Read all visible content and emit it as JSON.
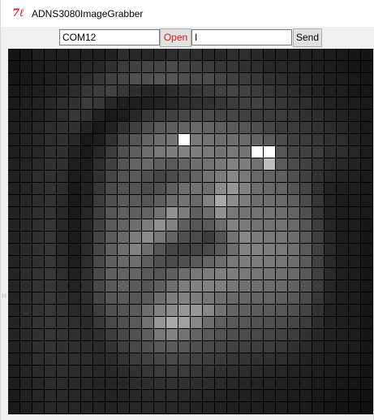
{
  "window": {
    "title": "ADNS3080ImageGrabber",
    "icon": "tk-feather-icon"
  },
  "toolbar": {
    "port_value": "COM12",
    "open_label": "Open",
    "command_value": "I",
    "send_label": "Send"
  },
  "image": {
    "grid_size": 30,
    "description_colors": {
      "background": "#000000",
      "accent": "#cc1f1f"
    },
    "pixels": [
      [
        20,
        22,
        30,
        30,
        30,
        30,
        32,
        30,
        33,
        45,
        40,
        38,
        40,
        45,
        50,
        45,
        40,
        40,
        45,
        45,
        40,
        35,
        35,
        33,
        30,
        30,
        28,
        25,
        22,
        20
      ],
      [
        20,
        25,
        28,
        30,
        30,
        35,
        40,
        40,
        50,
        60,
        65,
        70,
        70,
        75,
        70,
        65,
        60,
        55,
        55,
        50,
        45,
        40,
        40,
        40,
        35,
        30,
        30,
        25,
        22,
        20
      ],
      [
        22,
        25,
        28,
        32,
        35,
        40,
        45,
        55,
        65,
        70,
        80,
        80,
        85,
        85,
        80,
        75,
        75,
        70,
        65,
        60,
        55,
        50,
        45,
        40,
        38,
        35,
        30,
        28,
        25,
        22
      ],
      [
        25,
        28,
        30,
        35,
        40,
        45,
        55,
        60,
        65,
        55,
        45,
        40,
        40,
        45,
        50,
        55,
        60,
        65,
        70,
        65,
        60,
        55,
        50,
        45,
        40,
        35,
        30,
        30,
        25,
        22
      ],
      [
        25,
        30,
        35,
        40,
        45,
        50,
        60,
        55,
        40,
        30,
        30,
        32,
        35,
        40,
        45,
        48,
        50,
        55,
        60,
        65,
        65,
        60,
        55,
        50,
        45,
        40,
        35,
        30,
        28,
        24
      ],
      [
        28,
        30,
        35,
        40,
        45,
        55,
        50,
        35,
        25,
        28,
        40,
        55,
        60,
        65,
        70,
        75,
        75,
        70,
        70,
        65,
        60,
        60,
        60,
        55,
        50,
        45,
        40,
        35,
        30,
        25
      ],
      [
        30,
        32,
        38,
        45,
        50,
        50,
        35,
        25,
        35,
        50,
        65,
        80,
        90,
        95,
        100,
        105,
        100,
        95,
        90,
        85,
        80,
        70,
        60,
        60,
        55,
        50,
        45,
        40,
        32,
        25
      ],
      [
        30,
        35,
        40,
        45,
        50,
        40,
        25,
        30,
        50,
        70,
        85,
        100,
        110,
        115,
        255,
        120,
        115,
        110,
        110,
        105,
        100,
        90,
        75,
        65,
        60,
        55,
        50,
        45,
        35,
        28
      ],
      [
        30,
        35,
        40,
        48,
        50,
        35,
        25,
        40,
        60,
        80,
        95,
        110,
        120,
        125,
        130,
        125,
        120,
        115,
        120,
        115,
        255,
        255,
        85,
        70,
        65,
        60,
        50,
        45,
        38,
        28
      ],
      [
        32,
        36,
        42,
        50,
        48,
        30,
        28,
        45,
        65,
        85,
        100,
        105,
        95,
        90,
        100,
        110,
        115,
        120,
        130,
        125,
        115,
        190,
        90,
        75,
        65,
        55,
        45,
        40,
        35,
        28
      ],
      [
        32,
        38,
        45,
        50,
        45,
        28,
        30,
        50,
        70,
        85,
        90,
        80,
        70,
        75,
        85,
        100,
        115,
        125,
        135,
        120,
        105,
        100,
        95,
        80,
        65,
        50,
        40,
        35,
        32,
        26
      ],
      [
        32,
        38,
        45,
        50,
        45,
        25,
        32,
        55,
        75,
        85,
        85,
        75,
        80,
        95,
        110,
        115,
        110,
        140,
        150,
        130,
        110,
        105,
        100,
        85,
        70,
        50,
        35,
        30,
        30,
        25
      ],
      [
        34,
        40,
        45,
        52,
        42,
        25,
        35,
        60,
        80,
        90,
        90,
        85,
        95,
        110,
        115,
        105,
        130,
        170,
        140,
        125,
        110,
        110,
        105,
        95,
        75,
        55,
        35,
        28,
        28,
        24
      ],
      [
        34,
        40,
        46,
        52,
        40,
        25,
        38,
        62,
        85,
        95,
        95,
        100,
        115,
        145,
        125,
        95,
        110,
        145,
        120,
        115,
        115,
        115,
        110,
        100,
        80,
        55,
        35,
        28,
        28,
        24
      ],
      [
        34,
        40,
        48,
        54,
        40,
        26,
        40,
        65,
        90,
        100,
        110,
        125,
        145,
        130,
        95,
        85,
        90,
        110,
        130,
        120,
        115,
        115,
        115,
        105,
        85,
        60,
        38,
        28,
        28,
        22
      ],
      [
        34,
        40,
        48,
        54,
        40,
        26,
        42,
        68,
        92,
        105,
        125,
        140,
        120,
        100,
        80,
        75,
        60,
        85,
        115,
        135,
        125,
        120,
        118,
        110,
        88,
        62,
        40,
        28,
        28,
        22
      ],
      [
        36,
        42,
        50,
        55,
        42,
        28,
        44,
        70,
        95,
        110,
        130,
        110,
        85,
        70,
        65,
        70,
        75,
        90,
        110,
        130,
        130,
        125,
        120,
        112,
        90,
        65,
        42,
        30,
        28,
        22
      ],
      [
        36,
        42,
        50,
        55,
        44,
        30,
        46,
        72,
        95,
        105,
        110,
        95,
        80,
        75,
        80,
        90,
        100,
        110,
        120,
        125,
        125,
        122,
        118,
        110,
        90,
        65,
        42,
        30,
        28,
        22
      ],
      [
        36,
        44,
        52,
        56,
        46,
        32,
        48,
        74,
        95,
        100,
        100,
        90,
        85,
        95,
        110,
        120,
        125,
        128,
        125,
        120,
        118,
        115,
        112,
        105,
        88,
        64,
        42,
        30,
        28,
        22
      ],
      [
        36,
        44,
        52,
        56,
        48,
        34,
        48,
        72,
        90,
        95,
        90,
        85,
        95,
        110,
        125,
        130,
        130,
        125,
        118,
        112,
        110,
        108,
        105,
        98,
        82,
        60,
        40,
        30,
        28,
        22
      ],
      [
        36,
        44,
        52,
        56,
        50,
        38,
        46,
        68,
        85,
        90,
        85,
        90,
        110,
        125,
        130,
        125,
        118,
        110,
        105,
        102,
        100,
        98,
        95,
        88,
        75,
        56,
        38,
        30,
        28,
        22
      ],
      [
        36,
        44,
        52,
        56,
        52,
        42,
        44,
        62,
        80,
        85,
        90,
        110,
        130,
        140,
        150,
        150,
        135,
        115,
        100,
        95,
        92,
        90,
        86,
        80,
        68,
        50,
        36,
        30,
        28,
        22
      ],
      [
        36,
        44,
        52,
        56,
        52,
        46,
        42,
        56,
        72,
        80,
        90,
        115,
        150,
        170,
        160,
        135,
        110,
        95,
        88,
        85,
        82,
        80,
        76,
        70,
        58,
        45,
        35,
        30,
        28,
        22
      ],
      [
        36,
        42,
        50,
        54,
        52,
        48,
        42,
        48,
        62,
        72,
        82,
        95,
        120,
        130,
        115,
        100,
        90,
        82,
        78,
        75,
        72,
        70,
        66,
        60,
        50,
        40,
        34,
        30,
        28,
        22
      ],
      [
        34,
        40,
        48,
        52,
        50,
        48,
        44,
        42,
        52,
        62,
        72,
        80,
        88,
        90,
        86,
        80,
        74,
        70,
        66,
        64,
        62,
        60,
        56,
        50,
        42,
        36,
        32,
        30,
        28,
        22
      ],
      [
        32,
        38,
        46,
        50,
        48,
        46,
        44,
        40,
        44,
        52,
        60,
        66,
        70,
        72,
        70,
        66,
        62,
        58,
        55,
        52,
        50,
        48,
        45,
        40,
        36,
        32,
        30,
        28,
        26,
        22
      ],
      [
        30,
        36,
        42,
        46,
        46,
        44,
        42,
        40,
        40,
        44,
        50,
        54,
        58,
        60,
        58,
        55,
        52,
        48,
        46,
        44,
        42,
        40,
        38,
        34,
        32,
        30,
        28,
        26,
        24,
        20
      ],
      [
        28,
        34,
        40,
        44,
        44,
        42,
        40,
        38,
        38,
        40,
        44,
        46,
        48,
        50,
        48,
        46,
        44,
        42,
        40,
        38,
        36,
        34,
        32,
        30,
        30,
        28,
        26,
        24,
        22,
        20
      ],
      [
        26,
        32,
        38,
        42,
        42,
        40,
        38,
        36,
        36,
        38,
        40,
        42,
        44,
        44,
        42,
        40,
        38,
        36,
        34,
        32,
        32,
        30,
        30,
        28,
        28,
        26,
        24,
        22,
        20,
        18
      ],
      [
        24,
        30,
        36,
        40,
        40,
        38,
        36,
        34,
        34,
        36,
        38,
        40,
        40,
        40,
        38,
        36,
        34,
        32,
        30,
        30,
        30,
        28,
        28,
        26,
        26,
        24,
        22,
        20,
        18,
        16
      ]
    ]
  }
}
